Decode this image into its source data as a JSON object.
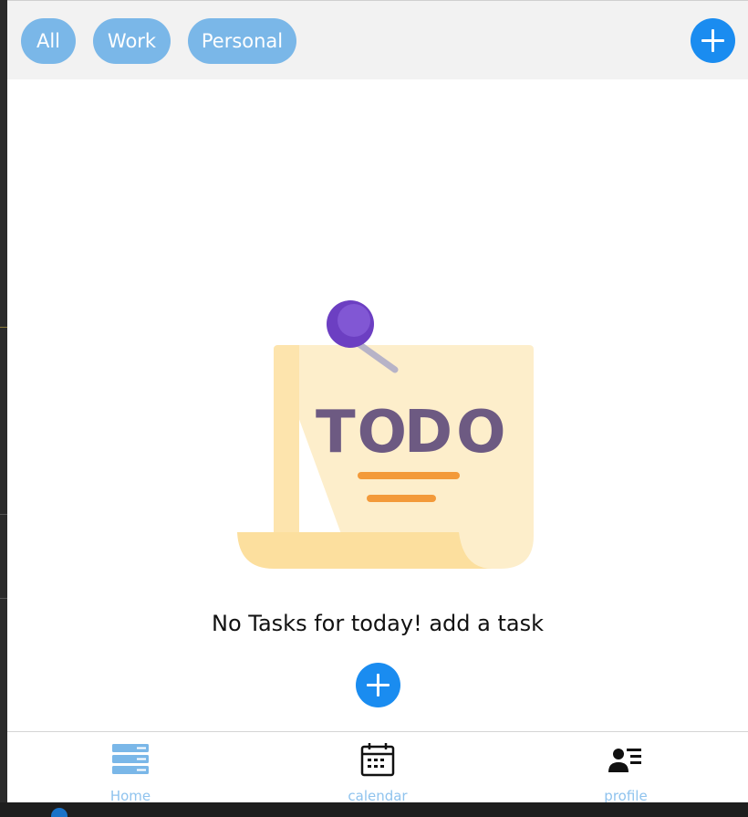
{
  "filters": {
    "all_label": "All",
    "work_label": "Work",
    "personal_label": "Personal"
  },
  "header": {
    "add_icon": "plus-icon"
  },
  "main": {
    "illustration_text": "TO DO",
    "empty_message": "No Tasks for today! add a task",
    "add_icon": "plus-icon"
  },
  "bottom_nav": {
    "items": [
      {
        "label": "Home",
        "icon": "home-list-icon"
      },
      {
        "label": "calendar",
        "icon": "calendar-icon"
      },
      {
        "label": "profile",
        "icon": "profile-card-icon"
      }
    ]
  },
  "colors": {
    "chip": "#7ab7e8",
    "accent": "#1a8cf0",
    "nav_label": "#8fc3ee",
    "header_bg": "#f2f2f2"
  }
}
